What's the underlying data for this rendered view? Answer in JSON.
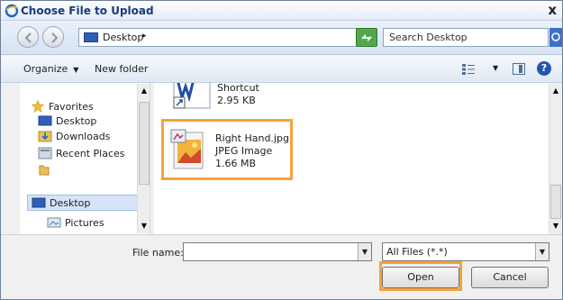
{
  "window": {
    "title": "Choose File to Upload",
    "close_glyph": "x"
  },
  "address": {
    "location": "Desktop",
    "crumb_arrow": "▸",
    "dropdown_glyph": "▼",
    "search_placeholder": "Search Desktop"
  },
  "toolbar": {
    "organize_label": "Organize",
    "organize_arrow": "▼",
    "new_folder_label": "New folder",
    "views_arrow": "▼",
    "help_glyph": "?"
  },
  "sidebar": {
    "items": [
      {
        "label": "Favorites",
        "icon": "star-icon"
      },
      {
        "label": "Desktop",
        "icon": "desktop-icon"
      },
      {
        "label": "Downloads",
        "icon": "downloads-icon"
      },
      {
        "label": "Recent Places",
        "icon": "recent-places-icon"
      },
      {
        "label": "",
        "icon": "folder-icon"
      },
      {
        "label": "Desktop",
        "icon": "desktop-icon",
        "selected": true
      },
      {
        "label": "Pictures",
        "icon": "pictures-icon"
      }
    ]
  },
  "files": [
    {
      "name": "Shortcut",
      "size": "2.95 KB"
    },
    {
      "name": "Right Hand.jpg",
      "type": "JPEG Image",
      "size": "1.66 MB",
      "selected": true
    }
  ],
  "bottom": {
    "file_name_label": "File name:",
    "file_name_value": "",
    "filter_value": "All Files (*.*)",
    "dropdown_glyph": "▼",
    "open_label": "Open",
    "cancel_label": "Cancel"
  },
  "colors": {
    "highlight": "#f3a23a",
    "accent": "#2f5fb7"
  }
}
